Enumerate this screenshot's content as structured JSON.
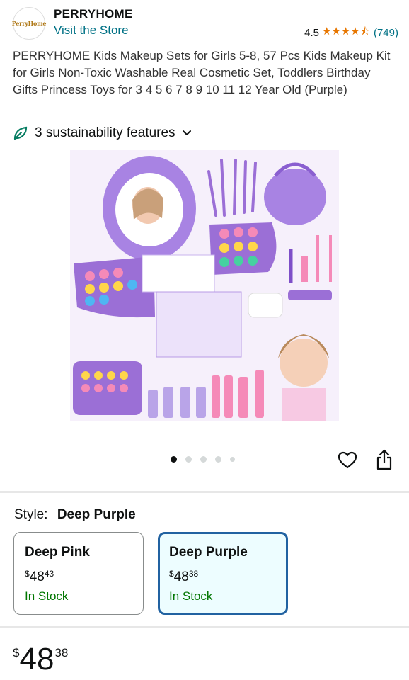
{
  "store": {
    "logo_text": "PerryHome",
    "name": "PERRYHOME",
    "visit_label": "Visit the Store",
    "rating_value": "4.5",
    "rating_stars": 4.5,
    "rating_count": "(749)"
  },
  "product": {
    "title": "PERRYHOME Kids Makeup Sets for Girls 5-8, 57 Pcs Kids Makeup Kit for Girls Non-Toxic Washable Real Cosmetic Set, Toddlers Birthday Gifts Princess Toys for 3 4 5 6 7 8 9 10 11 12 Year Old (Purple)",
    "sustainability_label": "3 sustainability features"
  },
  "gallery": {
    "image_count": 5,
    "active_index": 0
  },
  "icons": {
    "leaf": "leaf-icon",
    "chevron": "chevron-down-icon",
    "heart": "heart-icon",
    "share": "share-icon"
  },
  "style": {
    "label": "Style:",
    "selected": "Deep Purple",
    "options": [
      {
        "name": "Deep Pink",
        "currency": "$",
        "whole": "48",
        "fraction": "43",
        "stock": "In Stock",
        "selected": false
      },
      {
        "name": "Deep Purple",
        "currency": "$",
        "whole": "48",
        "fraction": "38",
        "stock": "In Stock",
        "selected": true
      }
    ]
  },
  "price": {
    "currency": "$",
    "whole": "48",
    "fraction": "38"
  },
  "colors": {
    "link": "#007185",
    "star": "#e77600",
    "in_stock": "#007600",
    "selected_border": "#2162a1",
    "product_purple": "#9b6fd6"
  }
}
